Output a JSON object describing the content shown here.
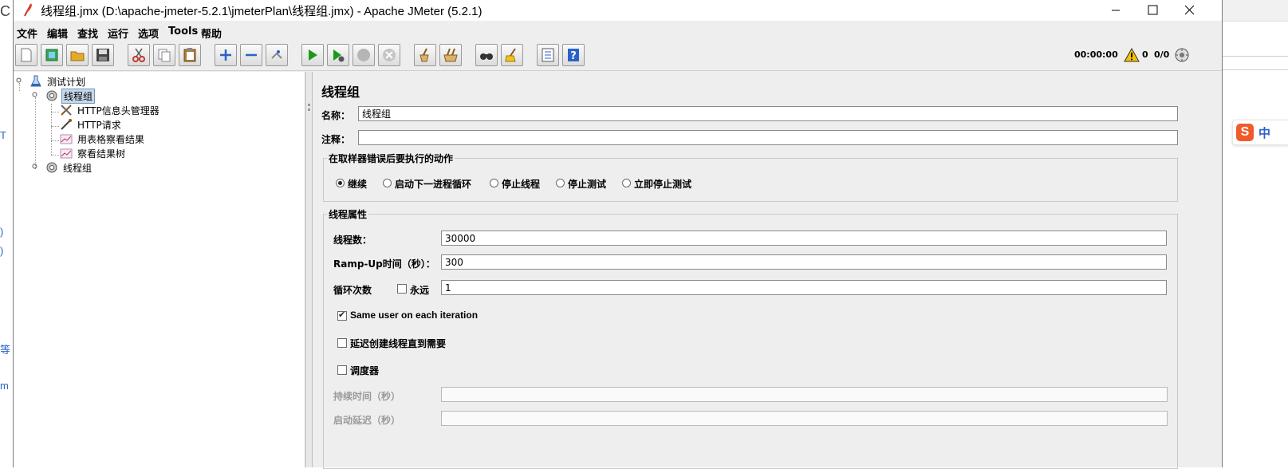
{
  "window": {
    "title": "线程组.jmx (D:\\apache-jmeter-5.2.1\\jmeterPlan\\线程组.jmx) - Apache JMeter (5.2.1)"
  },
  "menu": [
    "文件",
    "编辑",
    "查找",
    "运行",
    "选项",
    "Tools",
    "帮助"
  ],
  "toolbar": {
    "buttons": [
      "new-icon",
      "templates-icon",
      "open-icon",
      "save-icon",
      "cut-icon",
      "copy-icon",
      "paste-icon",
      "expand-icon",
      "collapse-icon",
      "toggle-icon",
      "start-icon",
      "start-no-pause-icon",
      "stop-icon",
      "shutdown-icon",
      "clear-icon",
      "clear-all-icon",
      "search-icon",
      "reset-search-icon",
      "function-helper-icon",
      "help-icon"
    ],
    "timer": "00:00:00",
    "warning_count": "0",
    "threads": "0/0"
  },
  "tree": {
    "test_plan": "测试计划",
    "thread_group_1": "线程组",
    "children": [
      "HTTP信息头管理器",
      "HTTP请求",
      "用表格察看结果",
      "察看结果树"
    ],
    "thread_group_2": "线程组"
  },
  "panel": {
    "title": "线程组",
    "name_label": "名称：",
    "name_value": "线程组",
    "comment_label": "注释：",
    "comment_value": "",
    "error_group_title": "在取样器错误后要执行的动作",
    "error_actions": [
      "继续",
      "启动下一进程循环",
      "停止线程",
      "停止测试",
      "立即停止测试"
    ],
    "error_selected": "继续",
    "thread_props_title": "线程属性",
    "threads_label": "线程数：",
    "threads_value": "30000",
    "rampup_label": "Ramp-Up时间（秒）：",
    "rampup_value": "300",
    "loop_label": "循环次数",
    "forever_label": "永远",
    "loop_value": "1",
    "same_user_label": "Same user on each iteration",
    "delay_label": "延迟创建线程直到需要",
    "scheduler_label": "调度器",
    "duration_label": "持续时间（秒）",
    "duration_value": "",
    "startup_delay_label": "启动延迟（秒）",
    "startup_delay_value": ""
  },
  "background": {
    "ime_label": "中",
    "left_edge_chars": [
      "T",
      ")",
      ")",
      "等",
      "m"
    ]
  },
  "colors": {
    "selection": "#c8d8ea",
    "start_green": "#1a9a1a",
    "warning_yellow": "#f5c400"
  }
}
